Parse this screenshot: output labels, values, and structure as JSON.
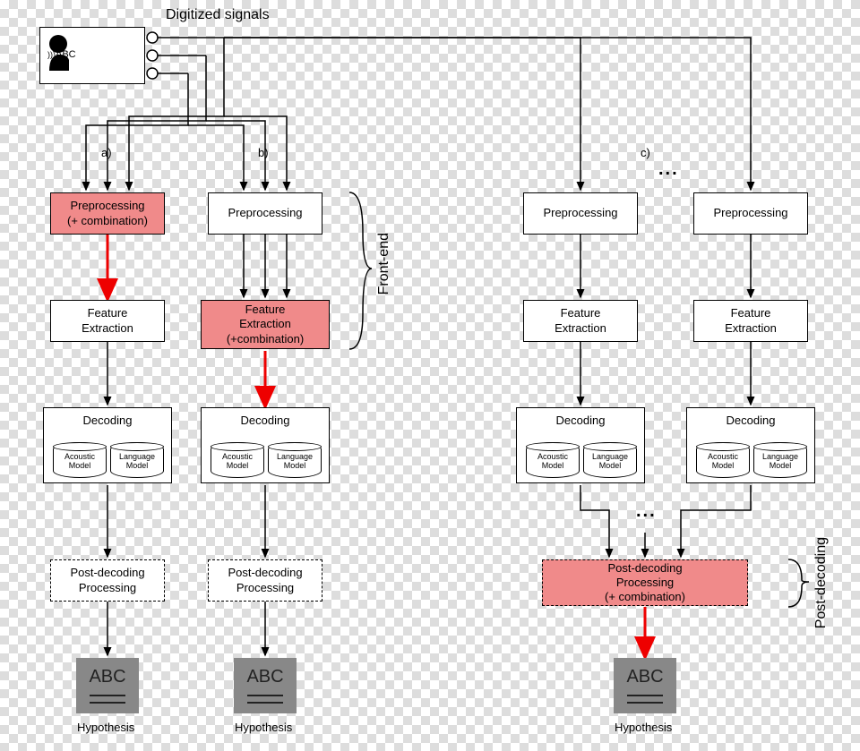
{
  "top": {
    "title": "Digitized signals",
    "speechText": "ABC"
  },
  "pipelines": {
    "a": {
      "label": "a)",
      "preprocessing": "Preprocessing\n(+ combination)",
      "feature": "Feature\nExtraction",
      "decoding": "Decoding",
      "am": "Acoustic\nModel",
      "lm": "Language\nModel",
      "post": "Post-decoding\nProcessing",
      "out": "ABC",
      "outLabel": "Hypothesis"
    },
    "b": {
      "label": "b)",
      "preprocessing": "Preprocessing",
      "feature": "Feature\nExtraction\n(+combination)",
      "decoding": "Decoding",
      "am": "Acoustic\nModel",
      "lm": "Language\nModel",
      "post": "Post-decoding\nProcessing",
      "out": "ABC",
      "outLabel": "Hypothesis"
    },
    "c": {
      "label": "c)",
      "preprocessing": "Preprocessing",
      "feature": "Feature\nExtraction",
      "decoding": "Decoding",
      "am": "Acoustic\nModel",
      "lm": "Language\nModel",
      "post": "Post-decoding\nProcessing\n(+ combination)",
      "out": "ABC",
      "outLabel": "Hypothesis"
    }
  },
  "sideLabels": {
    "frontend": "Front-end",
    "postdecoding": "Post-decoding"
  }
}
